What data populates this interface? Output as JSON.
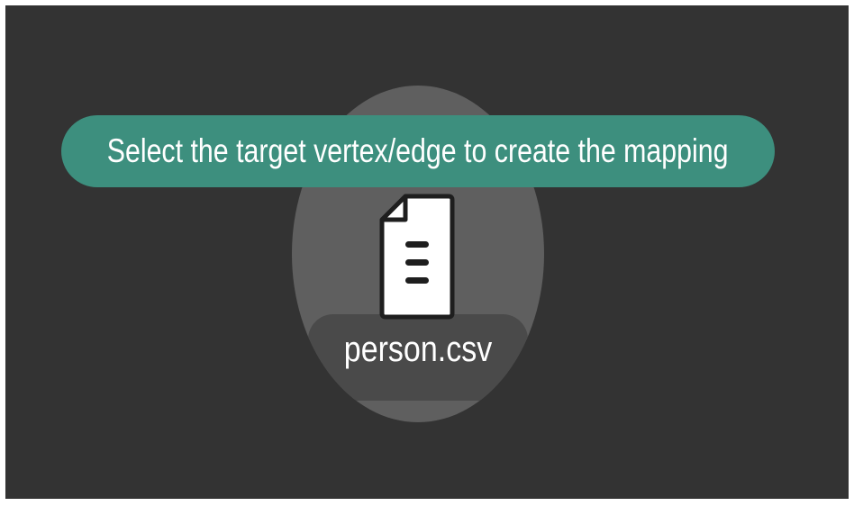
{
  "hint": {
    "text": "Select the target vertex/edge to create the mapping"
  },
  "file_node": {
    "file_name": "person.csv",
    "icon": "document-icon"
  },
  "colors": {
    "canvas_background": "#333333",
    "node_fill": "#5f5f5f",
    "toast_accent": "#3d8f7e",
    "text": "#ffffff"
  }
}
